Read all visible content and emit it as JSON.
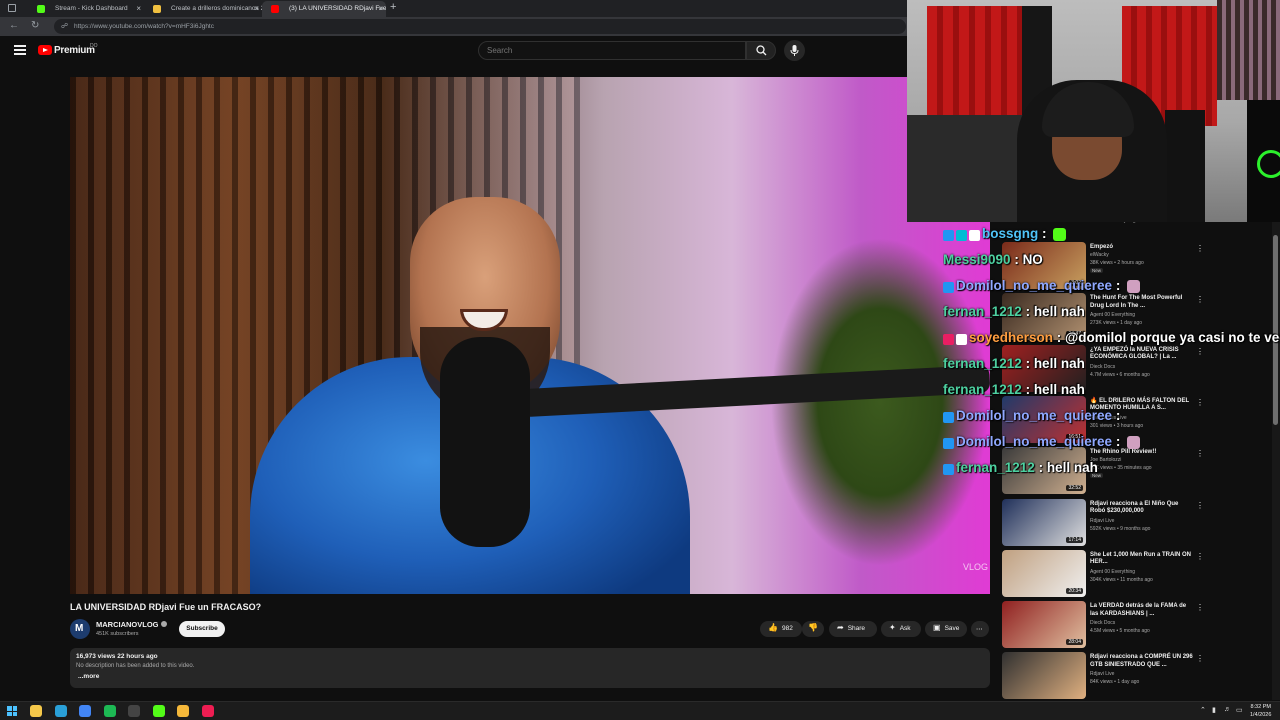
{
  "browser": {
    "tabs": [
      {
        "label": "Stream - Kick Dashboard",
        "favicon": "kick-favicon",
        "color": "#53fc18",
        "active": false
      },
      {
        "label": "Create a drilleros dominicanos 20...",
        "favicon": "doc-favicon",
        "color": "#f0c040",
        "active": false
      },
      {
        "label": "(3) LA UNIVERSIDAD RDjavi Fue un...",
        "favicon": "youtube-favicon",
        "color": "#ff0000",
        "active": true
      }
    ],
    "url": "https://www.youtube.com/watch?v=mHF3i6Jghtc"
  },
  "masthead": {
    "logo_text": "Premium",
    "region": "DO",
    "search_placeholder": "Search"
  },
  "video": {
    "title": "LA UNIVERSIDAD RDjavi Fue un FRACASO?",
    "channel": "MARCIANOVLOG",
    "subscribers": "451K subscribers",
    "subscribe_label": "Subscribe",
    "likes": "982",
    "share_label": "Share",
    "ask_label": "Ask",
    "save_label": "Save",
    "watermark": "VLOG",
    "views_time": "16,973 views  22 hours ago",
    "description": "No description has been added to this video.",
    "more_label": "...more"
  },
  "partial_stats": "32 views • 2 days ago",
  "recommendations": [
    {
      "title": "Empezó",
      "channel": "elWacky",
      "stats": "38K views • 2 hours ago",
      "duration": "3:02",
      "badge": "New",
      "colors": [
        "#7a2a1a",
        "#c8a060"
      ]
    },
    {
      "title": "The Hunt For The Most Powerful Drug Lord In The ...",
      "channel": "Agent 00 Everything",
      "stats": "273K views • 1 day ago",
      "duration": "24:47",
      "badge": "",
      "colors": [
        "#3a2a20",
        "#b09070"
      ]
    },
    {
      "title": "¿YA EMPEZÓ la NUEVA CRISIS ECONÓMICA GLOBAL? | La ...",
      "channel": "Dieck Docs",
      "stats": "4.7M views • 6 months ago",
      "duration": "",
      "badge": "",
      "colors": [
        "#a02020",
        "#202020"
      ]
    },
    {
      "title": "🔥 EL DRILERO MÁS FALTON DEL MOMENTO HUMILLA A S...",
      "channel": "Reacciones Live",
      "stats": "301 views • 3 hours ago",
      "duration": "16:51",
      "badge": "",
      "colors": [
        "#203a6a",
        "#c03030"
      ]
    },
    {
      "title": "The Rhino Pill Review!!",
      "channel": "Joe Bartolozzi",
      "stats": "20K views • 35 minutes ago",
      "duration": "32:52",
      "badge": "New",
      "colors": [
        "#3a3a3a",
        "#d0b090"
      ]
    },
    {
      "title": "Rdjavi reacciona a El Niño Que Robó $230,000,000",
      "channel": "Rdjavi Live",
      "stats": "592K views • 9 months ago",
      "duration": "17:14",
      "badge": "",
      "colors": [
        "#20305a",
        "#e0e0e0"
      ]
    },
    {
      "title": "She Let 1,000 Men Run a TRAIN ON HER...",
      "channel": "Agent 00 Everything",
      "stats": "304K views • 11 months ago",
      "duration": "20:34",
      "badge": "",
      "colors": [
        "#c0a080",
        "#f0f0f0"
      ]
    },
    {
      "title": "La VERDAD detrás de la FAMA de las KARDASHIANS | ...",
      "channel": "Dieck Docs",
      "stats": "4.5M views • 5 months ago",
      "duration": "28:04",
      "badge": "",
      "colors": [
        "#902020",
        "#e0c0a0"
      ]
    },
    {
      "title": "Rdjavi reacciona a COMPRÉ UN 296 GTB SINIESTRADO QUE ...",
      "channel": "Rdjavi Live",
      "stats": "84K views • 1 day ago",
      "duration": "",
      "badge": "",
      "colors": [
        "#303030",
        "#e0b080"
      ]
    }
  ],
  "chat": [
    {
      "user": "bossgng",
      "color": "#4fc3f7",
      "message": "",
      "badges": [
        "#2196f3",
        "#00bcd4",
        "#ffffff"
      ],
      "emote": "#53fc18"
    },
    {
      "user": "Messi9090",
      "color": "#4dd0a0",
      "message": "NO",
      "badges": [],
      "emote": ""
    },
    {
      "user": "Domilol_no_me_quierее",
      "color": "#8fa8ff",
      "message": "",
      "badges": [
        "#2196f3"
      ],
      "emote": "#d0a0c0"
    },
    {
      "user": "fernan_1212",
      "color": "#4dd0a0",
      "message": "hell nah",
      "badges": [],
      "emote": ""
    },
    {
      "user": "soyedherson",
      "color": "#ff9e40",
      "message": "@domilol porque ya casi no te veo",
      "badges": [
        "#e91e63",
        "#ffffff"
      ],
      "emote": ""
    },
    {
      "user": "fernan_1212",
      "color": "#4dd0a0",
      "message": "hell nah",
      "badges": [],
      "emote": ""
    },
    {
      "user": "fernan_1212",
      "color": "#4dd0a0",
      "message": "hell nah",
      "badges": [],
      "emote": ""
    },
    {
      "user": "Domilol_no_me_quierее",
      "color": "#8fa8ff",
      "message": "",
      "badges": [
        "#2196f3"
      ],
      "emote": ""
    },
    {
      "user": "Domilol_no_me_quierее",
      "color": "#8fa8ff",
      "message": "",
      "badges": [
        "#2196f3"
      ],
      "emote": "#d0a0c0"
    },
    {
      "user": "fernan_1212",
      "color": "#4dd0a0",
      "message": "hell nah",
      "badges": [
        "#2196f3"
      ],
      "emote": ""
    }
  ],
  "taskbar": {
    "apps": [
      {
        "name": "file-explorer-icon",
        "color": "#f5c84a"
      },
      {
        "name": "edge-icon",
        "color": "#2aa0d8"
      },
      {
        "name": "chrome-icon",
        "color": "#4285f4"
      },
      {
        "name": "spotify-icon",
        "color": "#1db954"
      },
      {
        "name": "obs-icon",
        "color": "#444444"
      },
      {
        "name": "kick-icon",
        "color": "#53fc18"
      },
      {
        "name": "app-icon",
        "color": "#f5b83a"
      },
      {
        "name": "tiktok-icon",
        "color": "#ee1d52"
      }
    ],
    "time": "8:32 PM",
    "date": "1/4/2026"
  }
}
